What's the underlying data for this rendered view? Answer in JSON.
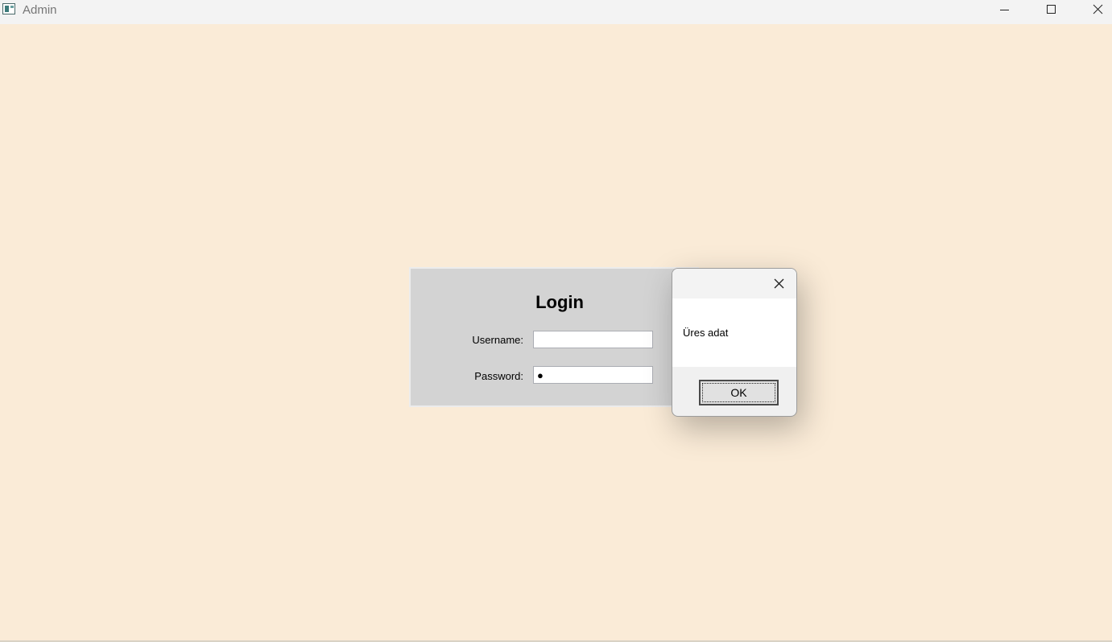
{
  "window": {
    "title": "Admin",
    "background": "#faebd7",
    "icons": {
      "app": "app-window-icon",
      "minimize": "minimize-icon",
      "maximize": "maximize-icon",
      "close": "close-icon"
    }
  },
  "login": {
    "title": "Login",
    "username_label": "Username:",
    "username_value": "",
    "password_label": "Password:",
    "password_value": "●",
    "panel_color": "#d3d3d3"
  },
  "message_box": {
    "text": "Üres adat",
    "ok_label": "OK",
    "close_icon": "close-icon"
  }
}
